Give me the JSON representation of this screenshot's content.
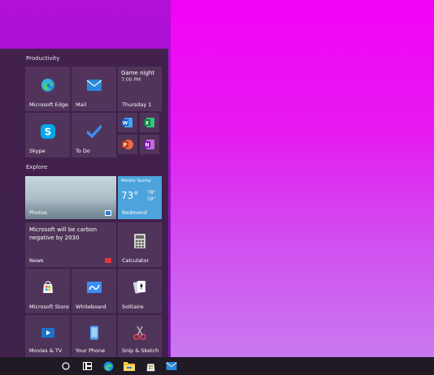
{
  "start": {
    "productivity_label": "Productivity",
    "explore_label": "Explore",
    "tiles": {
      "edge": "Microsoft Edge",
      "mail": "Mail",
      "calendar_event": "Game night",
      "calendar_time": "7:00 PM",
      "calendar_date": "Thursday 1",
      "skype": "Skype",
      "todo": "To Do",
      "photos": "Photos",
      "weather_condition": "Mostly Sunny",
      "weather_temp": "73°",
      "weather_high": "78°",
      "weather_low": "58°",
      "weather_city": "Redmond",
      "news_headline": "Microsoft will be carbon negative by 2030",
      "news": "News",
      "calculator": "Calculator",
      "store": "Microsoft Store",
      "whiteboard": "Whiteboard",
      "solitaire": "Solitaire",
      "movies": "Movies & TV",
      "phone": "Your Phone",
      "snip": "Snip & Sketch"
    },
    "office_icons": [
      "word-icon",
      "excel-icon",
      "powerpoint-icon",
      "onenote-icon"
    ]
  },
  "taskbar": {
    "icons": [
      "search-circle-icon",
      "task-view-icon",
      "edge-icon",
      "file-explorer-icon",
      "store-icon",
      "mail-icon"
    ]
  },
  "colors": {
    "accent_blue": "#0078d4",
    "weather_tile": "#4da3dc",
    "menu_bg": "#3a2242"
  }
}
